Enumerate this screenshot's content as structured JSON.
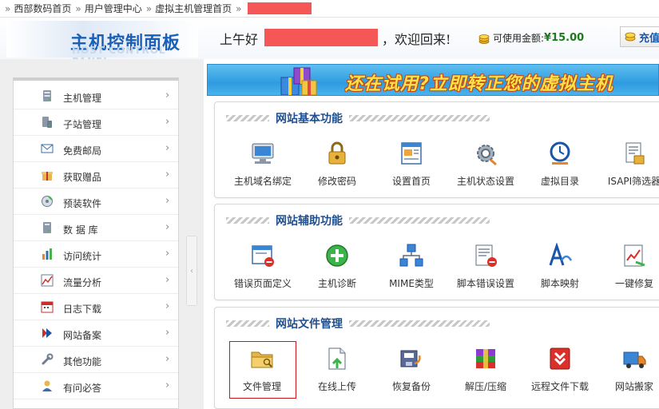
{
  "breadcrumb": {
    "items": [
      "西部数码首页",
      "用户管理中心",
      "虚拟主机管理首页"
    ],
    "sep": "»"
  },
  "header": {
    "logo_title": "主机控制面板",
    "logo_subtitle": "HOST CONTROL PANEL",
    "greeting_prefix": "上午好",
    "greeting_suffix": "，欢迎回来!",
    "balance_label": "可使用金额:",
    "balance_value": "¥15.00",
    "recharge_label": "充值"
  },
  "sidebar": {
    "arrow": "›",
    "items": [
      {
        "label": "主机管理",
        "icon": "server-icon"
      },
      {
        "label": "子站管理",
        "icon": "substation-icon"
      },
      {
        "label": "免费邮局",
        "icon": "mail-icon"
      },
      {
        "label": "获取赠品",
        "icon": "gift-icon"
      },
      {
        "label": "预装软件",
        "icon": "software-icon"
      },
      {
        "label": "数 据 库",
        "icon": "database-icon"
      },
      {
        "label": "访问统计",
        "icon": "stats-icon"
      },
      {
        "label": "流量分析",
        "icon": "traffic-icon"
      },
      {
        "label": "日志下载",
        "icon": "log-icon"
      },
      {
        "label": "网站备案",
        "icon": "record-icon"
      },
      {
        "label": "其他功能",
        "icon": "wrench-icon"
      },
      {
        "label": "有问必答",
        "icon": "help-icon"
      }
    ]
  },
  "banner": {
    "text": "还在试用?立即转正您的虚拟主机"
  },
  "panels": [
    {
      "title": "网站基本功能",
      "tools": [
        {
          "label": "主机域名绑定",
          "icon": "domain-bind-icon"
        },
        {
          "label": "修改密码",
          "icon": "password-lock-icon"
        },
        {
          "label": "设置首页",
          "icon": "homepage-icon"
        },
        {
          "label": "主机状态设置",
          "icon": "gear-icon"
        },
        {
          "label": "虚拟目录",
          "icon": "clock-icon"
        },
        {
          "label": "ISAPI筛选器",
          "icon": "filter-icon"
        }
      ]
    },
    {
      "title": "网站辅助功能",
      "tools": [
        {
          "label": "错误页面定义",
          "icon": "error-page-icon"
        },
        {
          "label": "主机诊断",
          "icon": "diagnose-icon"
        },
        {
          "label": "MIME类型",
          "icon": "mime-icon"
        },
        {
          "label": "脚本错误设置",
          "icon": "script-error-icon"
        },
        {
          "label": "脚本映射",
          "icon": "script-map-icon"
        },
        {
          "label": "一键修复",
          "icon": "repair-icon"
        }
      ]
    },
    {
      "title": "网站文件管理",
      "tools": [
        {
          "label": "文件管理",
          "icon": "folder-icon"
        },
        {
          "label": "在线上传",
          "icon": "upload-icon"
        },
        {
          "label": "恢复备份",
          "icon": "restore-icon"
        },
        {
          "label": "解压/压缩",
          "icon": "archive-icon"
        },
        {
          "label": "远程文件下载",
          "icon": "download-icon"
        },
        {
          "label": "网站搬家",
          "icon": "truck-icon"
        }
      ]
    }
  ]
}
